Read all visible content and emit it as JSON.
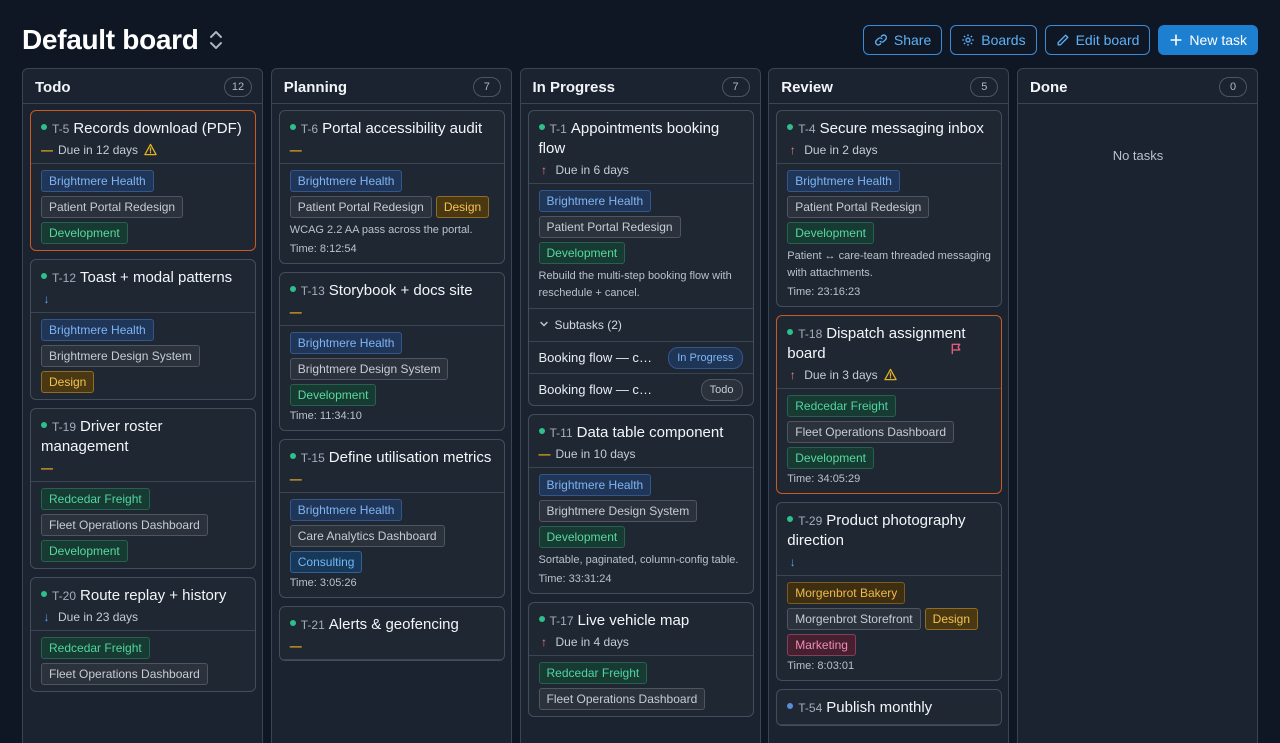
{
  "header": {
    "title": "Default board",
    "buttons": {
      "share": "Share",
      "boards": "Boards",
      "edit": "Edit board",
      "new_task": "New task"
    }
  },
  "colors": {
    "accent": "#1d7fcf",
    "alert_border": "#c85a22",
    "status_dot": "#2fbf8a"
  },
  "columns": [
    {
      "title": "Todo",
      "count": "12",
      "cards": [
        {
          "id": "T-5",
          "title": "Records download (PDF)",
          "priority": "—",
          "due": "Due in 12 days",
          "warning": true,
          "alert": true,
          "tags": [
            [
              "Brightmere Health",
              "client-blue"
            ],
            [
              "Patient Portal Redesign",
              "project"
            ],
            [
              "Development",
              "dev"
            ]
          ]
        },
        {
          "id": "T-12",
          "title": "Toast + modal patterns",
          "priority": "↓",
          "tags": [
            [
              "Brightmere Health",
              "client-blue"
            ],
            [
              "Brightmere Design System",
              "project"
            ],
            [
              "Design",
              "design"
            ]
          ]
        },
        {
          "id": "T-19",
          "title": "Driver roster management",
          "priority": "—",
          "tags": [
            [
              "Redcedar Freight",
              "client-green"
            ],
            [
              "Fleet Operations Dashboard",
              "project"
            ],
            [
              "Development",
              "dev"
            ]
          ]
        },
        {
          "id": "T-20",
          "title": "Route replay + history",
          "priority": "↓",
          "due": "Due in 23 days",
          "tags": [
            [
              "Redcedar Freight",
              "client-green"
            ],
            [
              "Fleet Operations Dashboard",
              "project"
            ]
          ]
        }
      ]
    },
    {
      "title": "Planning",
      "count": "7",
      "cards": [
        {
          "id": "T-6",
          "title": "Portal accessibility audit",
          "priority": "—",
          "tags": [
            [
              "Brightmere Health",
              "client-blue"
            ],
            [
              "Patient Portal Redesign",
              "project"
            ],
            [
              "Design",
              "design"
            ]
          ],
          "desc": "WCAG 2.2 AA pass across the portal.",
          "time": "Time: 8:12:54"
        },
        {
          "id": "T-13",
          "title": "Storybook + docs site",
          "priority": "—",
          "tags": [
            [
              "Brightmere Health",
              "client-blue"
            ],
            [
              "Brightmere Design System",
              "project"
            ],
            [
              "Development",
              "dev"
            ]
          ],
          "time": "Time: 11:34:10"
        },
        {
          "id": "T-15",
          "title": "Define utilisation metrics",
          "priority": "—",
          "tags": [
            [
              "Brightmere Health",
              "client-blue"
            ],
            [
              "Care Analytics Dashboard",
              "project"
            ],
            [
              "Consulting",
              "consulting"
            ]
          ],
          "time": "Time: 3:05:26"
        },
        {
          "id": "T-21",
          "title": "Alerts & geofencing",
          "priority": "—",
          "tags": []
        }
      ]
    },
    {
      "title": "In Progress",
      "count": "7",
      "cards": [
        {
          "id": "T-1",
          "title": "Appointments booking flow",
          "priority": "↑",
          "due": "Due in 6 days",
          "tags": [
            [
              "Brightmere Health",
              "client-blue"
            ],
            [
              "Patient Portal Redesign",
              "project"
            ],
            [
              "Development",
              "dev"
            ]
          ],
          "desc": "Rebuild the multi-step booking flow with reschedule + cancel.",
          "subtasks_label": "Subtasks (2)",
          "subtasks": [
            {
              "title": "Booking flow — calendar",
              "status": "In Progress",
              "kind": "inprog"
            },
            {
              "title": "Booking flow — confirmation",
              "status": "Todo",
              "kind": "todo"
            }
          ]
        },
        {
          "id": "T-11",
          "title": "Data table component",
          "priority": "—",
          "due": "Due in 10 days",
          "tags": [
            [
              "Brightmere Health",
              "client-blue"
            ],
            [
              "Brightmere Design System",
              "project"
            ],
            [
              "Development",
              "dev"
            ]
          ],
          "desc": "Sortable, paginated, column-config table.",
          "time": "Time: 33:31:24"
        },
        {
          "id": "T-17",
          "title": "Live vehicle map",
          "priority": "↑",
          "due": "Due in 4 days",
          "tags": [
            [
              "Redcedar Freight",
              "client-green"
            ],
            [
              "Fleet Operations Dashboard",
              "project"
            ]
          ]
        }
      ]
    },
    {
      "title": "Review",
      "count": "5",
      "cards": [
        {
          "id": "T-4",
          "title": "Secure messaging inbox",
          "priority": "↑",
          "due": "Due in 2 days",
          "tags": [
            [
              "Brightmere Health",
              "client-blue"
            ],
            [
              "Patient Portal Redesign",
              "project"
            ],
            [
              "Development",
              "dev"
            ]
          ],
          "desc": "Patient ↔ care-team threaded messaging with attachments.",
          "time": "Time: 23:16:23"
        },
        {
          "id": "T-18",
          "title": "Dispatch assignment board",
          "priority": "↑",
          "due": "Due in 3 days",
          "warning": true,
          "alert": true,
          "flag": true,
          "tags": [
            [
              "Redcedar Freight",
              "client-green"
            ],
            [
              "Fleet Operations Dashboard",
              "project"
            ],
            [
              "Development",
              "dev"
            ]
          ],
          "time": "Time: 34:05:29"
        },
        {
          "id": "T-29",
          "title": "Product photography direction",
          "priority": "↓",
          "tags": [
            [
              "Morgenbrot Bakery",
              "client-amber"
            ],
            [
              "Morgenbrot Storefront",
              "project"
            ],
            [
              "Design",
              "design"
            ],
            [
              "Marketing",
              "marketing"
            ]
          ],
          "time": "Time: 8:03:01"
        },
        {
          "id": "T-54",
          "title": "Publish monthly",
          "priority": "",
          "dot": "blue",
          "tags": []
        }
      ]
    },
    {
      "title": "Done",
      "count": "0",
      "empty": "No tasks",
      "cards": []
    }
  ]
}
